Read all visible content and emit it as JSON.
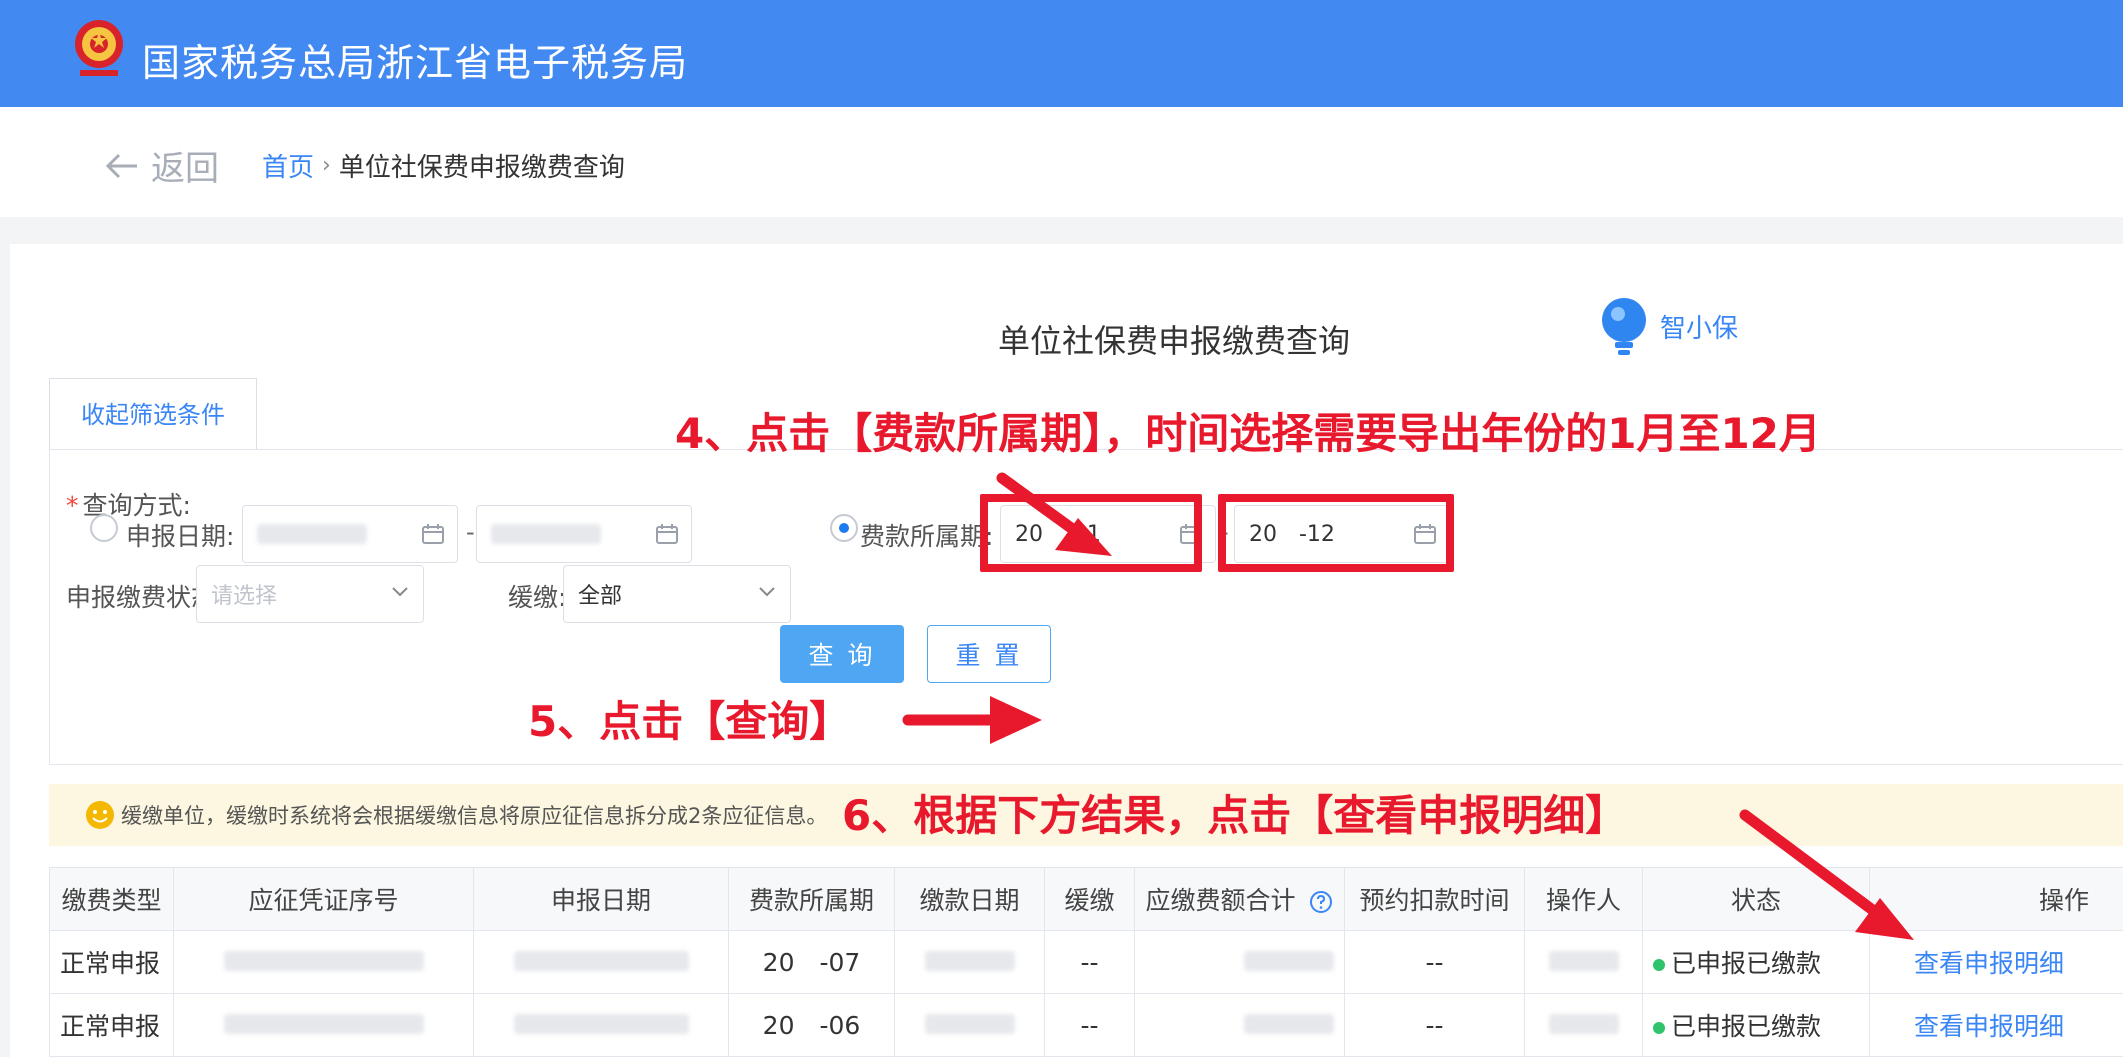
{
  "header": {
    "site_title": "国家税务总局浙江省电子税务局",
    "brand_color": "#4389f2"
  },
  "nav": {
    "back_label": "返回",
    "breadcrumb_home": "首页",
    "breadcrumb_sep": "›",
    "breadcrumb_current": "单位社保费申报缴费查询"
  },
  "page": {
    "title": "单位社保费申报缴费查询",
    "assistant_label": "智小保"
  },
  "filters": {
    "collapse_tab": "收起筛选条件",
    "query_mode_label": "查询方式:",
    "option_declare_date": "申报日期:",
    "option_fee_period": "费款所属期:",
    "selected_option": "fee_period",
    "period_start": "20 -01",
    "period_end": "20 -12",
    "range_sep": "-",
    "status_label": "申报缴费状态:",
    "status_placeholder": "请选择",
    "payment_label": "缓缴:",
    "payment_value": "全部",
    "query_button": "查 询",
    "reset_button": "重 置"
  },
  "annotations": {
    "step4": "4、点击【费款所属期】，时间选择需要导出年份的1月至12月",
    "step5": "5、点击【查询】",
    "step6": "6、根据下方结果，点击【查看申报明细】",
    "highlight_color": "#e8192c"
  },
  "notice": {
    "text": "缓缴单位，缓缴时系统将会根据缓缴信息将原应征信息拆分成2条应征信息。"
  },
  "table": {
    "columns": [
      "缴费类型",
      "应征凭证序号",
      "申报日期",
      "费款所属期",
      "缴款日期",
      "缓缴",
      "应缴费额合计",
      "预约扣款时间",
      "操作人",
      "状态",
      "操作"
    ],
    "rows": [
      {
        "type": "正常申报",
        "period": "20 -07",
        "deferred": "--",
        "schedule": "--",
        "status": "已申报已缴款",
        "action": "查看申报明细"
      },
      {
        "type": "正常申报",
        "period": "20 -06",
        "deferred": "--",
        "schedule": "--",
        "status": "已申报已缴款",
        "action": "查看申报明细"
      }
    ]
  }
}
